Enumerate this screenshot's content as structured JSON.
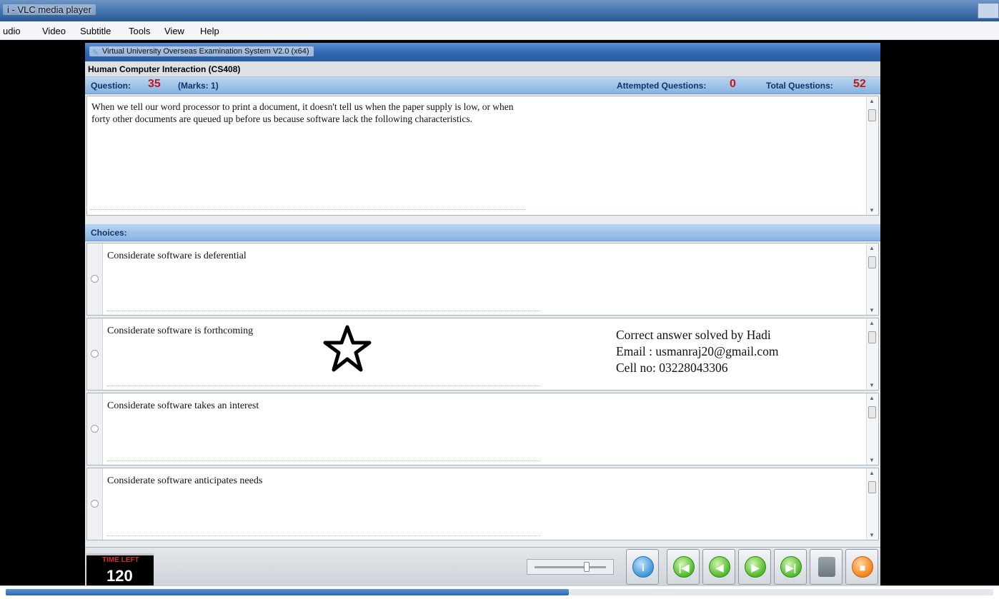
{
  "vlc": {
    "title": "i - VLC media player",
    "menu": [
      "udio",
      "Video",
      "Subtitle",
      "Tools",
      "View",
      "Help"
    ],
    "playback_progress_percent": 57
  },
  "exam": {
    "window_title": "Virtual University Overseas Examination System  V2.0 (x64)",
    "course": "Human Computer Interaction  (CS408)",
    "question_label": "Question:",
    "question_number": "35",
    "marks": "(Marks: 1)",
    "attempted_label": "Attempted Questions:",
    "attempted_value": "0",
    "total_label": "Total Questions:",
    "total_value": "52",
    "question_text": "When we tell our word processor to print a document, it doesn't tell  us when the paper supply is low, or when forty other documents are queued up before us because software lack the following characteristics.",
    "choices_label": "Choices:",
    "choices": [
      "Considerate software is deferential",
      "Considerate software is forthcoming",
      "Considerate software takes an interest",
      "Considerate software anticipates needs"
    ],
    "time_left_label": "TIME LEFT",
    "time_left_value": "120",
    "slider_level_percent": 75,
    "nav_buttons": [
      "info-button",
      "first-button",
      "previous-button",
      "next-button",
      "last-button",
      "save-button",
      "finish-button"
    ]
  },
  "overlay": {
    "watermark_line1": "Correct answer solved by Hadi",
    "watermark_line2": "Email : usmanraj20@gmail.com",
    "watermark_line3": "Cell no: 03228043306",
    "marked_choice_icon": "star-icon"
  },
  "colors": {
    "accent_blue": "#3469b6",
    "question_number_red": "#c01818",
    "timer_red": "#d23030"
  }
}
